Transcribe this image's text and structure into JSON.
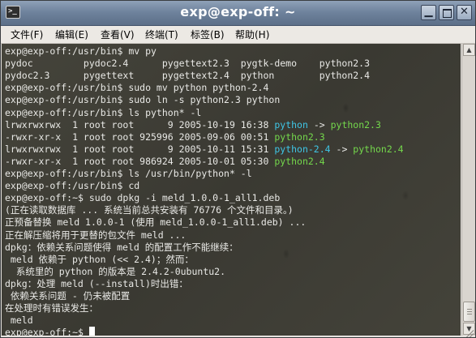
{
  "window": {
    "title": "exp@exp-off: ~",
    "app_icon_text": ">_",
    "buttons": {
      "minimize": "▁",
      "close": "✕"
    }
  },
  "menu": [
    "文件(F)",
    "编辑(E)",
    "查看(V)",
    "终端(T)",
    "标签(B)",
    "帮助(H)"
  ],
  "terminal": {
    "background_color": "#3d3c34",
    "colors": {
      "default": "#e9e9e6",
      "symlink": "#3fc6e6",
      "executable": "#74d84c"
    },
    "lines": [
      [
        {
          "t": "exp@exp-off:/usr/bin$ mv py"
        }
      ],
      [
        {
          "t": "pydoc         pydoc2.4      pygettext2.3  pygtk-demo    python2.3"
        }
      ],
      [
        {
          "t": "pydoc2.3      pygettext     pygettext2.4  python        python2.4"
        }
      ],
      [
        {
          "t": "exp@exp-off:/usr/bin$ sudo mv python python-2.4"
        }
      ],
      [
        {
          "t": "exp@exp-off:/usr/bin$ sudo ln -s python2.3 python"
        }
      ],
      [
        {
          "t": "exp@exp-off:/usr/bin$ ls python* -l"
        }
      ],
      [
        {
          "t": "lrwxrwxrwx  1 root root      9 2005-10-19 16:38 "
        },
        {
          "t": "python",
          "c": "cyan"
        },
        {
          "t": " -> "
        },
        {
          "t": "python2.3",
          "c": "green"
        }
      ],
      [
        {
          "t": "-rwxr-xr-x  1 root root 925996 2005-09-06 00:51 "
        },
        {
          "t": "python2.3",
          "c": "green"
        }
      ],
      [
        {
          "t": "lrwxrwxrwx  1 root root      9 2005-10-11 15:31 "
        },
        {
          "t": "python-2.4",
          "c": "cyan"
        },
        {
          "t": " -> "
        },
        {
          "t": "python2.4",
          "c": "green"
        }
      ],
      [
        {
          "t": "-rwxr-xr-x  1 root root 986924 2005-10-01 05:30 "
        },
        {
          "t": "python2.4",
          "c": "green"
        }
      ],
      [
        {
          "t": "exp@exp-off:/usr/bin$ ls /usr/bin/python* -l"
        }
      ],
      [
        {
          "t": "exp@exp-off:/usr/bin$ cd"
        }
      ],
      [
        {
          "t": "exp@exp-off:~$ sudo dpkg -i meld_1.0.0-1_all1.deb"
        }
      ],
      [
        {
          "t": "(正在读取数据库 ... 系统当前总共安装有 76776 个文件和目录。)"
        }
      ],
      [
        {
          "t": "正预备替换 meld 1.0.0-1 (使用 meld_1.0.0-1_all1.deb) ..."
        }
      ],
      [
        {
          "t": "正在解压缩将用于更替的包文件 meld ..."
        }
      ],
      [
        {
          "t": "dpkg：依赖关系问题使得 meld 的配置工作不能继续："
        }
      ],
      [
        {
          "t": " meld 依赖于 python (<< 2.4)；然而："
        }
      ],
      [
        {
          "t": "  系统里的 python 的版本是 2.4.2-0ubuntu2."
        }
      ],
      [
        {
          "t": "dpkg：处理 meld (--install)时出错："
        }
      ],
      [
        {
          "t": " 依赖关系问题 - 仍未被配置"
        }
      ],
      [
        {
          "t": "在处理时有错误发生："
        }
      ],
      [
        {
          "t": " meld"
        }
      ],
      [
        {
          "t": "exp@exp-off:~$ "
        },
        {
          "cursor": true
        }
      ]
    ]
  },
  "scrollbar": {
    "position_fraction": 1.0
  }
}
